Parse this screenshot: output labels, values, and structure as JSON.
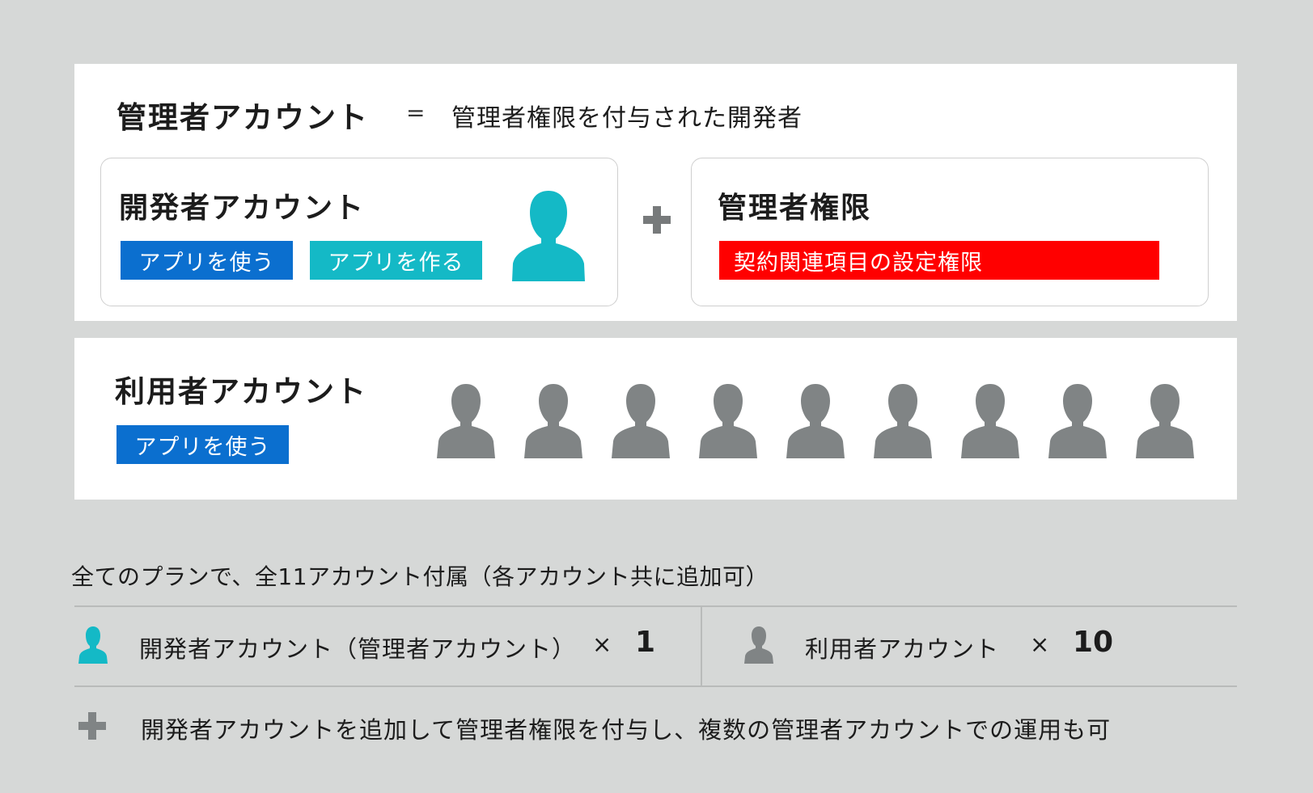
{
  "admin": {
    "title": "管理者アカウント",
    "equals": "=",
    "definition": "管理者権限を付与された開発者",
    "developer_card": {
      "title": "開発者アカウント",
      "tag_use": "アプリを使う",
      "tag_make": "アプリを作る"
    },
    "permission_card": {
      "title": "管理者権限",
      "tag": "契約関連項目の設定権限"
    }
  },
  "user": {
    "title": "利用者アカウント",
    "tag_use": "アプリを使う",
    "avatar_count": 9
  },
  "footer": {
    "heading": "全てのプランで、全11アカウント付属（各アカウント共に追加可）",
    "developer_row": {
      "label": "開発者アカウント（管理者アカウント）",
      "times": "×",
      "count": "1"
    },
    "user_row": {
      "label": "利用者アカウント",
      "times": "×",
      "count": "10"
    },
    "note": "開発者アカウントを追加して管理者権限を付与し、複数の管理者アカウントでの運用も可"
  },
  "colors": {
    "blue": "#0b6fcf",
    "teal": "#14b9c6",
    "red": "#ff0000",
    "gray_icon": "#808485",
    "background": "#d6d8d7"
  },
  "icons": {
    "developer": "person-icon",
    "user": "person-icon",
    "plus": "plus-icon"
  }
}
